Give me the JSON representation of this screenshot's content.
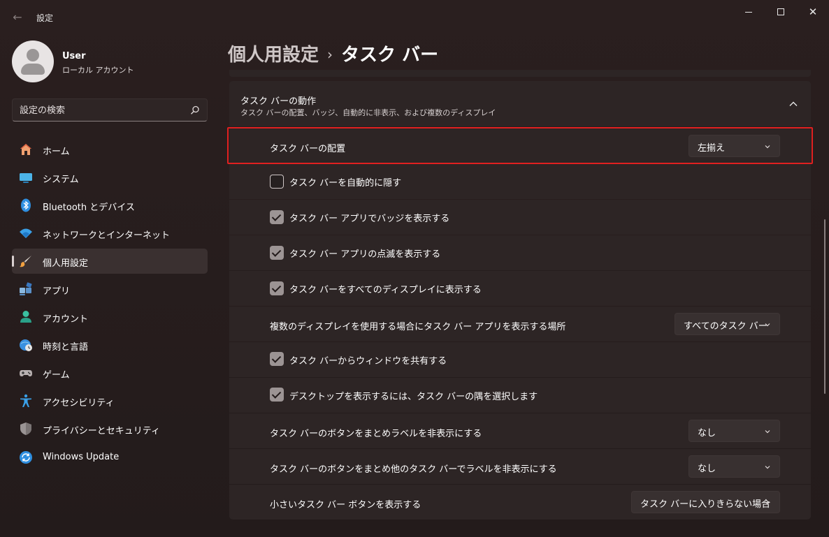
{
  "app": {
    "title": "設定",
    "back_icon": "←"
  },
  "user": {
    "name": "User",
    "type": "ローカル アカウント"
  },
  "search": {
    "placeholder": "設定の検索"
  },
  "sidebar": {
    "items": [
      {
        "label": "ホーム",
        "icon": "home-icon"
      },
      {
        "label": "システム",
        "icon": "display-icon"
      },
      {
        "label": "Bluetooth とデバイス",
        "icon": "bluetooth-icon"
      },
      {
        "label": "ネットワークとインターネット",
        "icon": "wifi-icon"
      },
      {
        "label": "個人用設定",
        "icon": "brush-icon"
      },
      {
        "label": "アプリ",
        "icon": "apps-icon"
      },
      {
        "label": "アカウント",
        "icon": "person-icon"
      },
      {
        "label": "時刻と言語",
        "icon": "globe-clock-icon"
      },
      {
        "label": "ゲーム",
        "icon": "gamepad-icon"
      },
      {
        "label": "アクセシビリティ",
        "icon": "accessibility-icon"
      },
      {
        "label": "プライバシーとセキュリティ",
        "icon": "shield-icon"
      },
      {
        "label": "Windows Update",
        "icon": "update-icon"
      }
    ]
  },
  "breadcrumb": {
    "parent": "個人用設定",
    "separator": "›",
    "current": "タスク バー"
  },
  "group": {
    "title": "タスク バーの動作",
    "description": "タスク バーの配置、バッジ、自動的に非表示、および複数のディスプレイ"
  },
  "rows": {
    "alignment": {
      "label": "タスク バーの配置",
      "value": "左揃え"
    },
    "autohide": {
      "label": "タスク バーを自動的に隠す",
      "checked": false
    },
    "badges": {
      "label": "タスク バー アプリでバッジを表示する",
      "checked": true
    },
    "flashing": {
      "label": "タスク バー アプリの点滅を表示する",
      "checked": true
    },
    "all_displays": {
      "label": "タスク バーをすべてのディスプレイに表示する",
      "checked": true
    },
    "multi_display": {
      "label": "複数のディスプレイを使用する場合にタスク バー アプリを表示する場所",
      "value": "すべてのタスク バー"
    },
    "share_window": {
      "label": "タスク バーからウィンドウを共有する",
      "checked": true
    },
    "show_desktop": {
      "label": "デスクトップを表示するには、タスク バーの隅を選択します",
      "checked": true
    },
    "combine_buttons": {
      "label": "タスク バーのボタンをまとめラベルを非表示にする",
      "value": "なし"
    },
    "combine_other": {
      "label": "タスク バーのボタンをまとめ他のタスク バーでラベルを非表示にする",
      "value": "なし"
    },
    "small_buttons": {
      "label": "小さいタスク バー ボタンを表示する",
      "value": "タスク バーに入りきらない場合"
    }
  },
  "colors": {
    "highlight": "#e02020",
    "background": "#231b1b",
    "card": "#2d2525"
  }
}
